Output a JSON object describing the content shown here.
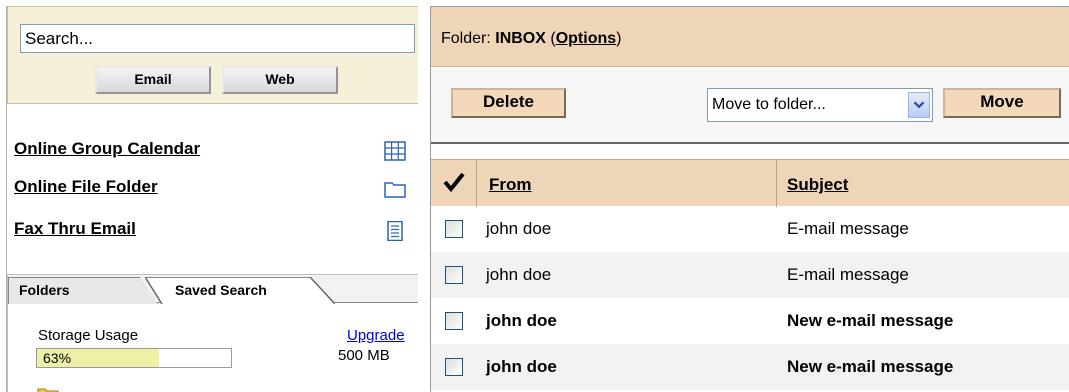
{
  "search": {
    "value": "Search...",
    "email_button": "Email",
    "web_button": "Web"
  },
  "tools": [
    {
      "label": "Online Group Calendar",
      "icon": "calendar-grid-icon"
    },
    {
      "label": "Online File Folder",
      "icon": "folder-icon"
    },
    {
      "label": "Fax Thru Email",
      "icon": "document-icon"
    }
  ],
  "side_tabs": [
    {
      "label": "Folders",
      "active": true
    },
    {
      "label": "Saved Search",
      "active": false
    }
  ],
  "storage": {
    "label": "Storage Usage",
    "upgrade_link": "Upgrade",
    "percent_text": "63%",
    "percent_value": 63,
    "size": "500 MB"
  },
  "folder": {
    "prefix": "Folder: ",
    "name": "INBOX",
    "options_open": "(",
    "options_label": "Options",
    "options_close": ")"
  },
  "actions": {
    "delete_label": "Delete",
    "move_select_value": "Move to folder...",
    "move_label": "Move"
  },
  "table": {
    "columns": {
      "from": "From",
      "subject": "Subject"
    },
    "rows": [
      {
        "from": "john doe",
        "subject": "E-mail message",
        "unread": false
      },
      {
        "from": "john doe",
        "subject": "E-mail message",
        "unread": false
      },
      {
        "from": "john doe",
        "subject": "New e-mail message",
        "unread": true
      },
      {
        "from": "john doe",
        "subject": "New e-mail message",
        "unread": true
      }
    ]
  },
  "colors": {
    "header_tan": "#efd5b8",
    "search_panel": "#f7f0d8",
    "storage_fill": "#eef0a6",
    "link_blue": "#0000ee"
  }
}
